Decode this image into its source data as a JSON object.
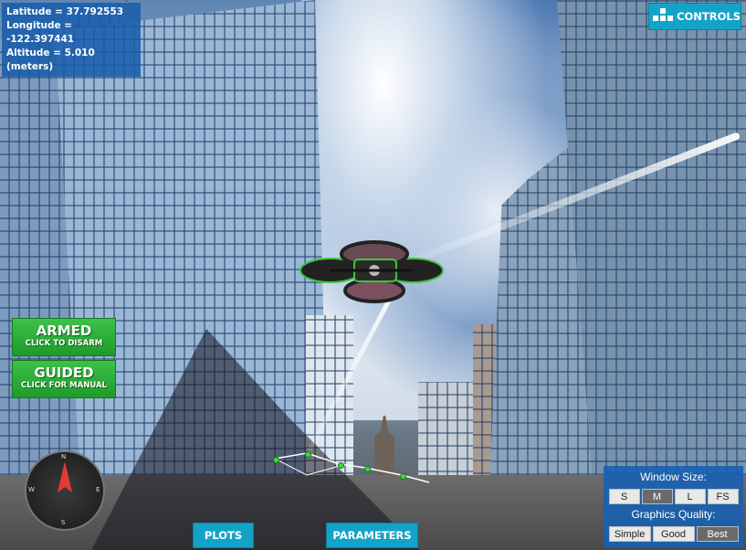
{
  "hud": {
    "latitude": "Latitude = 37.792553",
    "longitude": "Longitude = -122.397441",
    "altitude": "Altitude = 5.010 (meters)"
  },
  "controls": {
    "label": "CONTROLS",
    "icon": "grid-icon"
  },
  "mode_buttons": {
    "armed": {
      "title": "ARMED",
      "subtitle": "CLICK TO DISARM"
    },
    "guided": {
      "title": "GUIDED",
      "subtitle": "CLICK FOR MANUAL"
    }
  },
  "compass": {
    "north": "N",
    "south": "S",
    "east": "E",
    "west": "W",
    "needle_color": "#e03a3a"
  },
  "bottom_buttons": {
    "plots": "PLOTS",
    "parameters": "PARAMETERS"
  },
  "settings_panel": {
    "window_size_label": "Window Size:",
    "window_sizes": [
      "S",
      "M",
      "L",
      "FS"
    ],
    "window_size_selected": "M",
    "graphics_label": "Graphics Quality:",
    "graphics_options": [
      "Simple",
      "Good",
      "Best"
    ],
    "graphics_selected": "Best"
  },
  "colors": {
    "accent": "#14a3c8",
    "hud_panel": "#165caa",
    "armed_green": "#2aae36",
    "drone_accent": "#3ec43e"
  }
}
